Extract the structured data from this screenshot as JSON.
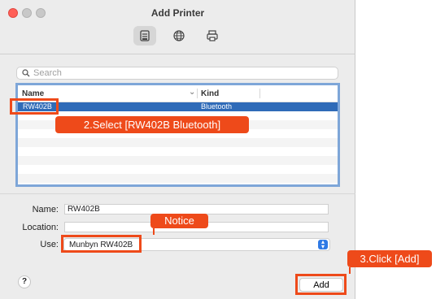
{
  "window": {
    "title": "Add Printer"
  },
  "toolbar": {
    "buttons": [
      {
        "name": "Default",
        "icon": "printer-icon",
        "active": true
      },
      {
        "name": "IP",
        "icon": "globe-icon",
        "active": false
      },
      {
        "name": "Windows",
        "icon": "printer-outline-icon",
        "active": false
      }
    ]
  },
  "search": {
    "placeholder": "Search",
    "icon": "search-icon"
  },
  "printer_list": {
    "columns": [
      "Name",
      "Kind"
    ],
    "rows": [
      {
        "name": "RW402B",
        "kind": "Bluetooth",
        "selected": true
      }
    ]
  },
  "details": {
    "name_label": "Name:",
    "name_value": "RW402B",
    "location_label": "Location:",
    "location_value": "",
    "use_label": "Use:",
    "use_value": "Munbyn RW402B"
  },
  "footer": {
    "help_label": "?",
    "add_label": "Add"
  },
  "annotations": {
    "step2": "2.Select [RW402B Bluetooth]",
    "notice": "Notice",
    "step3": "3.Click [Add]",
    "color": "#ee4a1a"
  },
  "colors": {
    "selection": "#2f6bb8",
    "list_border": "#7ea6d8",
    "close_button": "#ff5f57",
    "accent": "#2f7ae5"
  }
}
